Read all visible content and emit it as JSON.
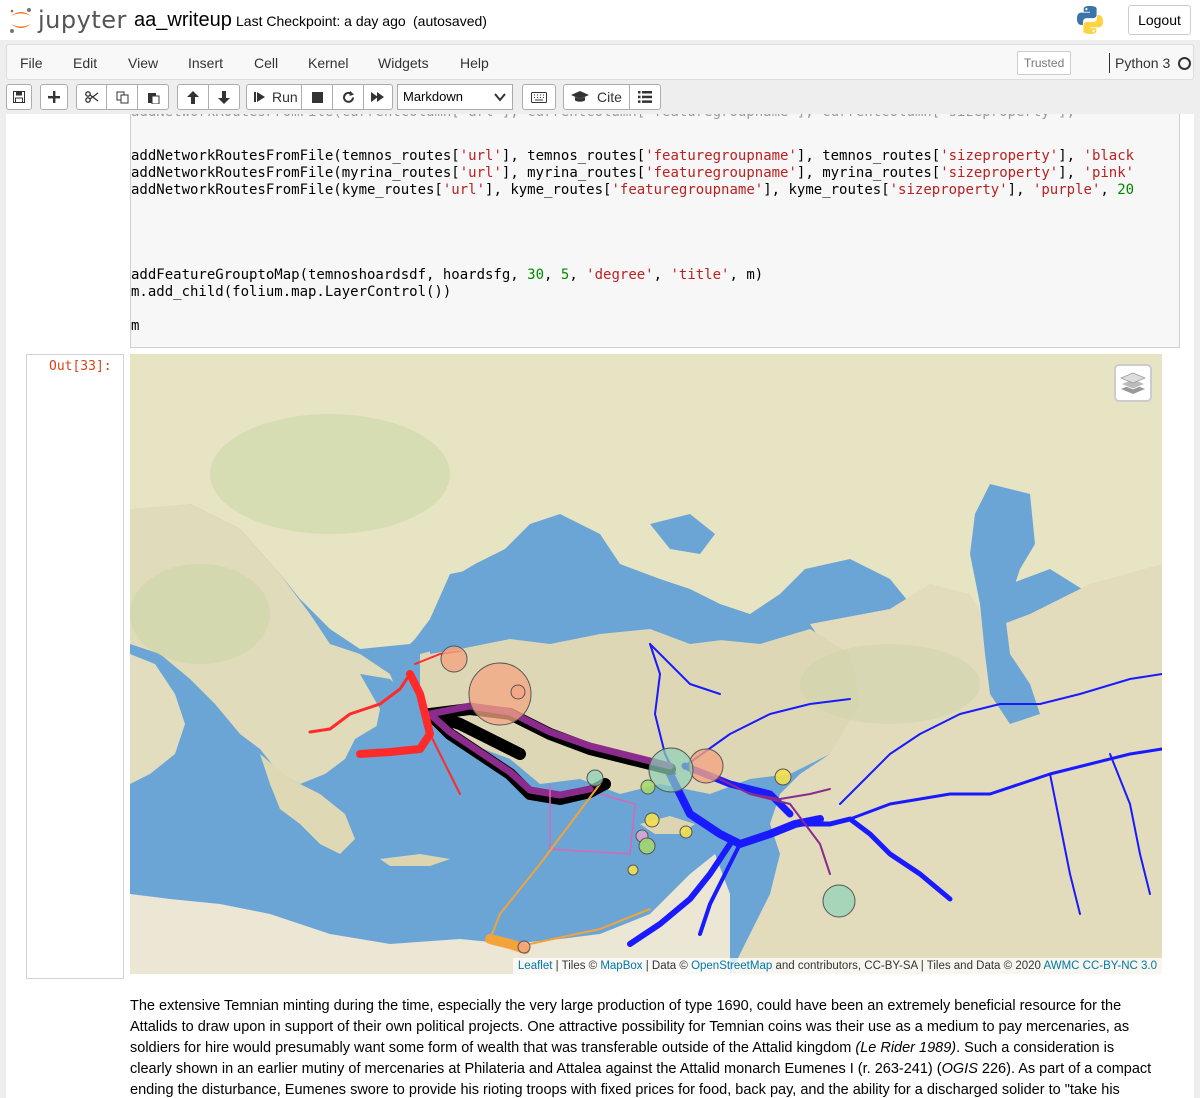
{
  "header": {
    "logo_text": "jupyter",
    "notebook_name": "aa_writeup",
    "checkpoint": "Last Checkpoint: a day ago",
    "autosave_status": "(autosaved)",
    "logout_label": "Logout"
  },
  "menubar": {
    "items": [
      "File",
      "Edit",
      "View",
      "Insert",
      "Cell",
      "Kernel",
      "Widgets",
      "Help"
    ],
    "trusted_label": "Trusted",
    "kernel_name": "Python 3"
  },
  "toolbar": {
    "run_label": "Run",
    "cell_type": "Markdown",
    "cite_label": "Cite"
  },
  "code_cell": {
    "lines": [
      "addNetworkRoutesFromFile(temnos_routes['url'], temnos_routes['featuregroupname'], temnos_routes['sizeproperty'], 'black",
      "addNetworkRoutesFromFile(myrina_routes['url'], myrina_routes['featuregroupname'], myrina_routes['sizeproperty'], 'pink'",
      "addNetworkRoutesFromFile(kyme_routes['url'], kyme_routes['featuregroupname'], kyme_routes['sizeproperty'], 'purple', 20",
      "addFeatureGrouptoMap(temnoshoardsdf, hoardsfg, 30, 5, 'degree', 'title', m)",
      "m.add_child(folium.map.LayerControl())",
      "m"
    ]
  },
  "output": {
    "prompt": "Out[33]:"
  },
  "map": {
    "attribution": {
      "leaflet": "Leaflet",
      "tiles_prefix": " | Tiles © ",
      "mapbox": "MapBox",
      "data_prefix": " | Data © ",
      "osm": "OpenStreetMap",
      "osm_suffix": " and contributors, CC-BY-SA | Tiles and Data © 2020 ",
      "awmc": "AWMC CC-BY-NC 3.0"
    },
    "colors": {
      "sea": "#6aa5d6",
      "land": "#ece7c8",
      "red_route": "#ff2a2a",
      "blue_route": "#1a1aff",
      "black_route": "#000000",
      "purple_route": "#8b2b8b",
      "orange_route": "#f3a33a"
    }
  },
  "text_cell": {
    "p1": "The extensive Temnian minting during the time, especially the very large production of type 1690, could have been an extremely beneficial resource for the Attalids to draw upon in support of their own political projects. One attractive possibility for Temnian coins was their use as a medium to pay mercenaries, as soldiers for hire would presumably want some form of wealth that was transferable outside of the Attalid kingdom ",
    "cite1": "(Le Rider 1989)",
    "p2": ". Such a consideration is clearly shown in an earlier mutiny of mercenaries at Philateria and Attalea against the Attalid monarch Eumenes I (r. 263-241) (",
    "cite2": "OGIS",
    "p3": " 226). As part of a compact ending the disturbance, Eumenes swore to provide his rioting troops with fixed prices for food, back pay, and the ability for a discharged solider to \"take his"
  }
}
